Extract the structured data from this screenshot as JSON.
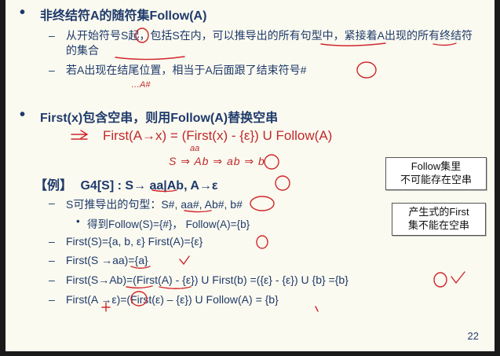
{
  "slide": {
    "bullet_follow": {
      "heading": "非终结符A的随符集Follow(A)",
      "sub1": "从开始符号S起，包括S在内，可以推导出的所有句型中，紧接着A出现的所有终结符的集合",
      "sub2": "若A出现在结尾位置，相当于A后面跟了结束符号#"
    },
    "handwritten_note": "…A#",
    "bullet_first": {
      "heading": "First(x)包含空串，则用Follow(A)替换空串",
      "formula": "First(A→x) = (First(x) - {ε}) U Follow(A)"
    },
    "handwritten_derivation": "S ⇒ Ab ⇒ ab ⇒ b",
    "handwritten_aa": "aa",
    "example": {
      "tag": "【例】",
      "grammar": "G4[S] : S→ aa|Ab,  A→ε",
      "sentential_forms": "S可推导出的句型：S#, aa#, Ab#, b#",
      "follow_result": "得到Follow(S)={#}， Follow(A)={b}",
      "first_sets": "First(S)={a, b, ε}     First(A)={ε}",
      "first_s_aa": "First(S →aa)={a}",
      "first_s_ab": "First(S→Ab)=(First(A) - {ε}) U First(b) =({ε} - {ε}) U {b} ={b}",
      "first_a_eps": "First(A →ε)=(First(ε) – {ε}) U Follow(A) = {b}"
    },
    "notes": [
      {
        "line1": "Follow集里",
        "line2": "不可能存在空串"
      },
      {
        "line1": "产生式的First",
        "line2": "集不能在空串"
      }
    ],
    "page_number": "22"
  }
}
